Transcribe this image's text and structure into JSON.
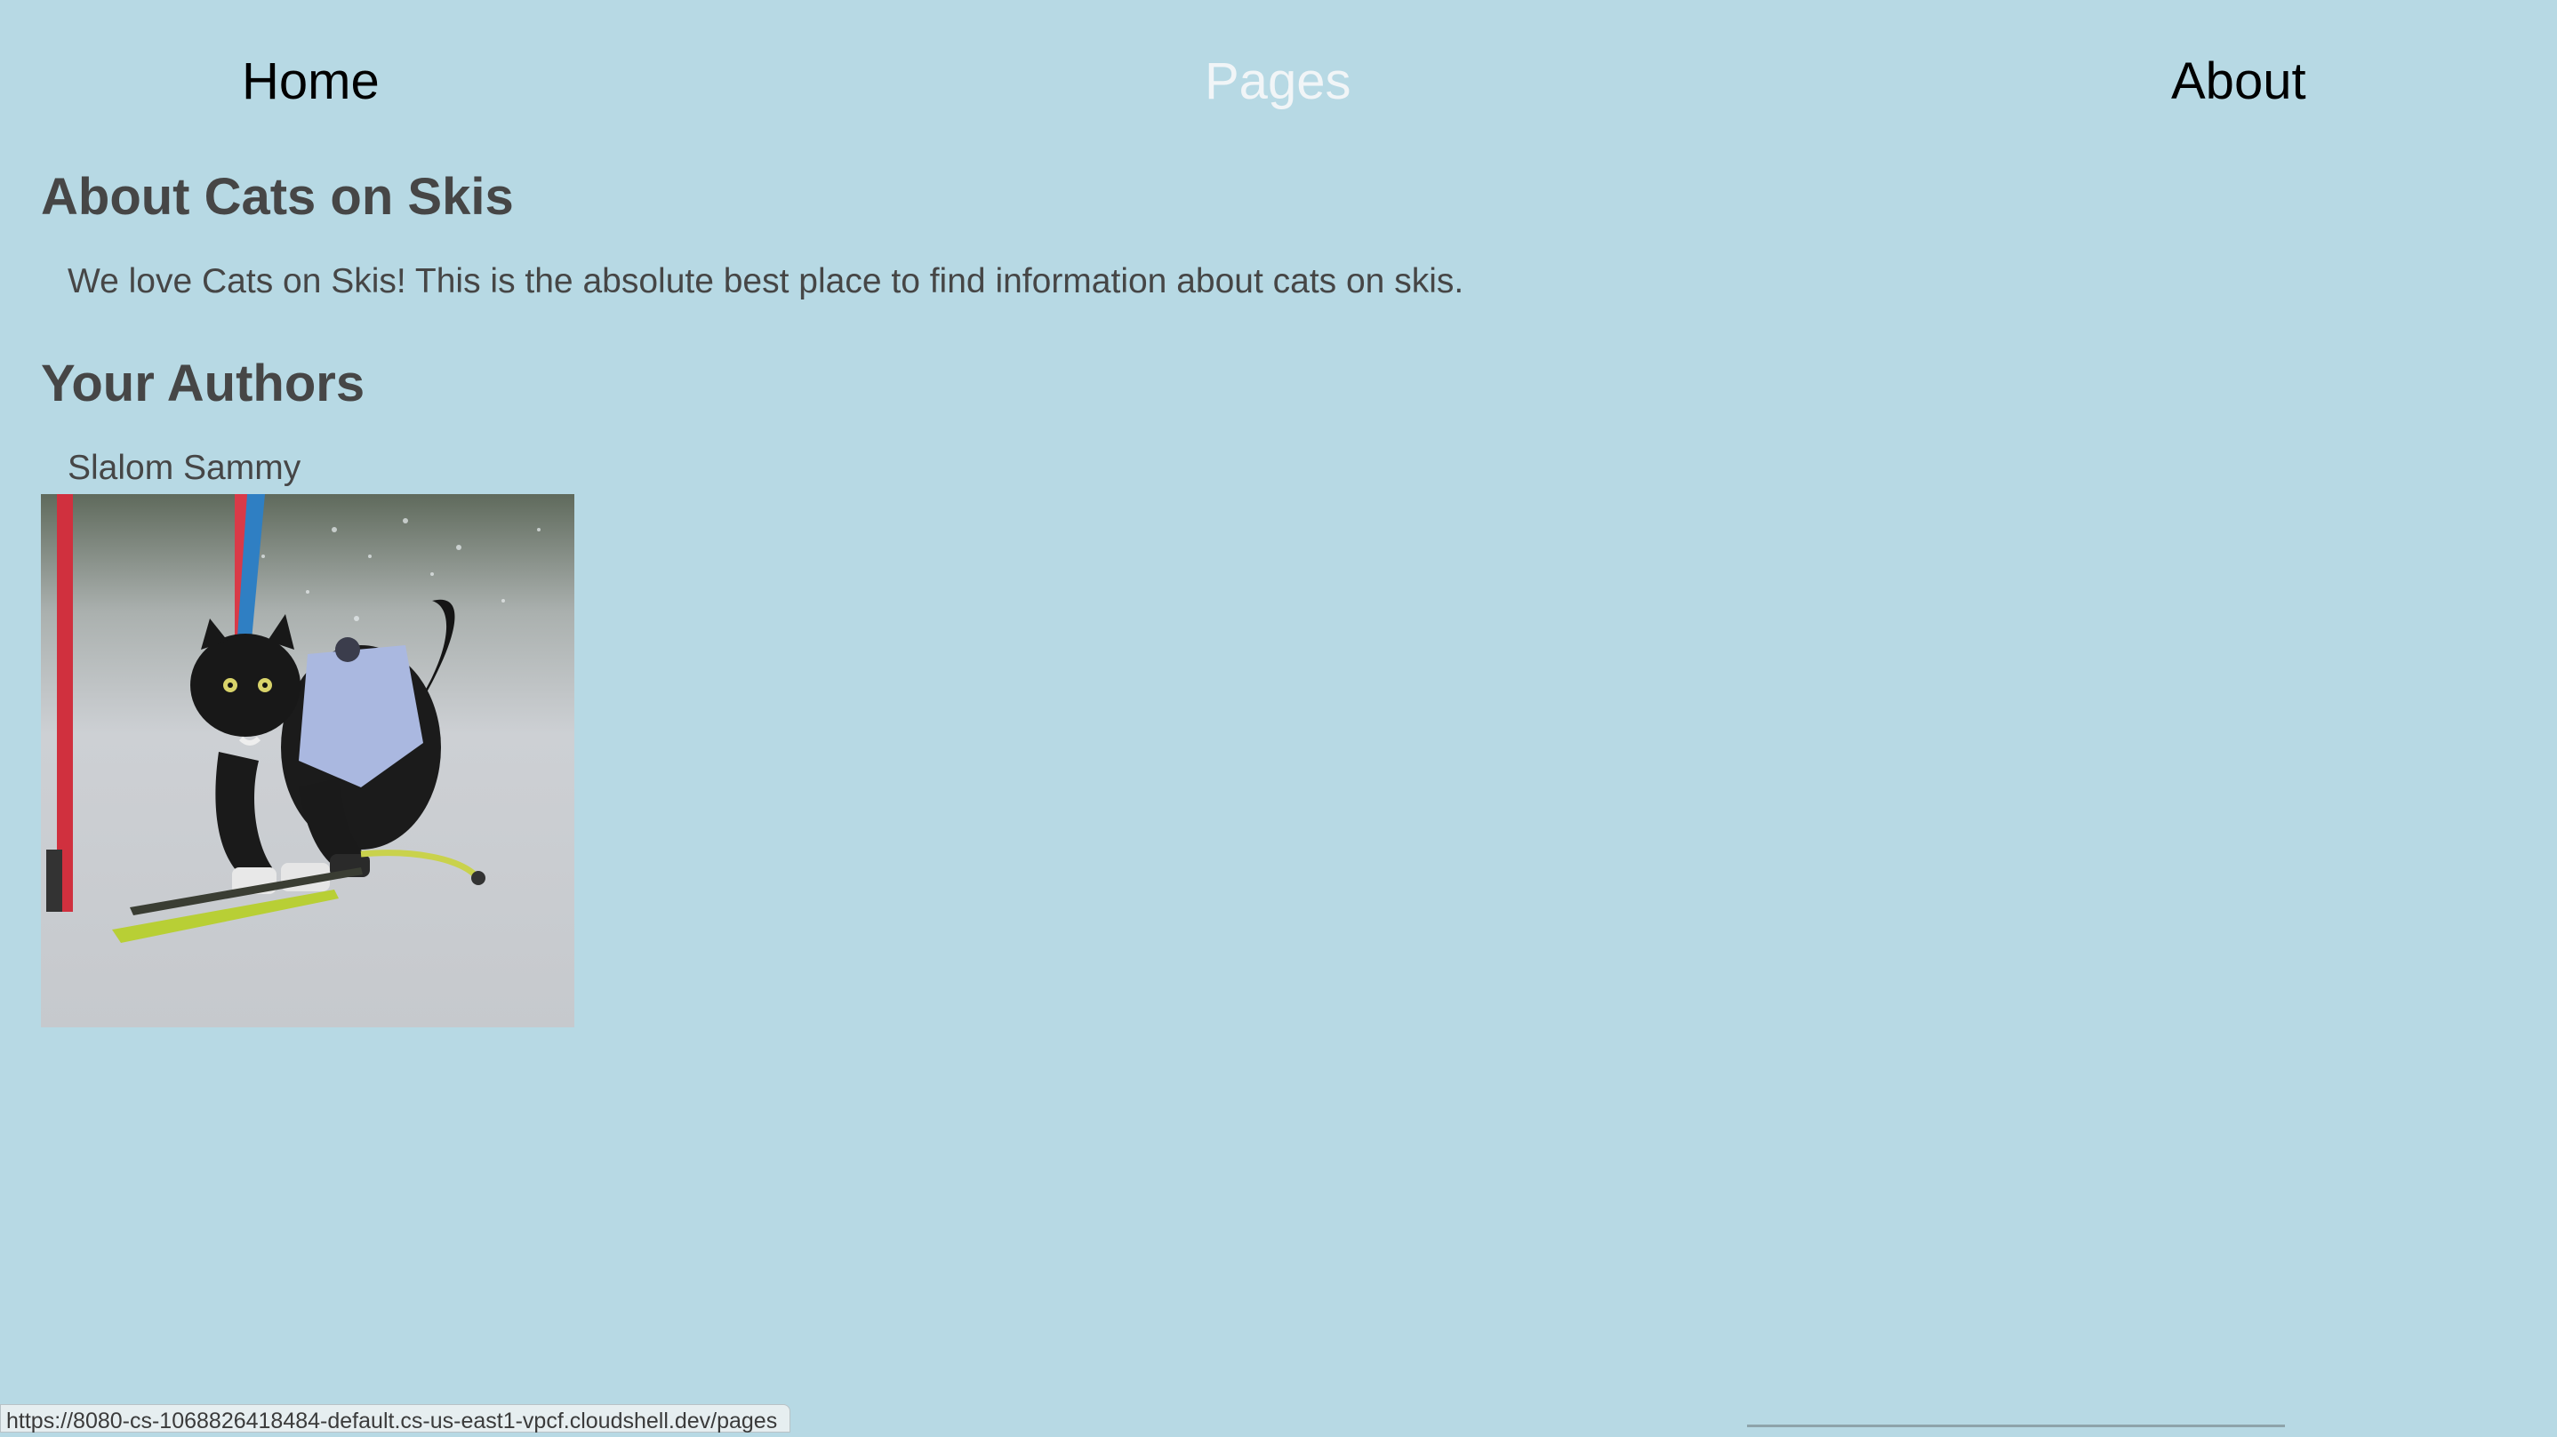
{
  "nav": {
    "home": "Home",
    "pages": "Pages",
    "about": "About"
  },
  "main": {
    "about_heading": "About Cats on Skis",
    "intro": "We love Cats on Skis! This is the absolute best place to find information about cats on skis.",
    "authors_heading": "Your Authors",
    "authors": [
      {
        "name": "Slalom Sammy"
      }
    ]
  },
  "status_bar": {
    "url": "https://8080-cs-1068826418484-default.cs-us-east1-vpcf.cloudshell.dev/pages"
  },
  "colors": {
    "background": "#b7d9e4",
    "nav_active": "#f1f5f7",
    "text": "#464646"
  }
}
